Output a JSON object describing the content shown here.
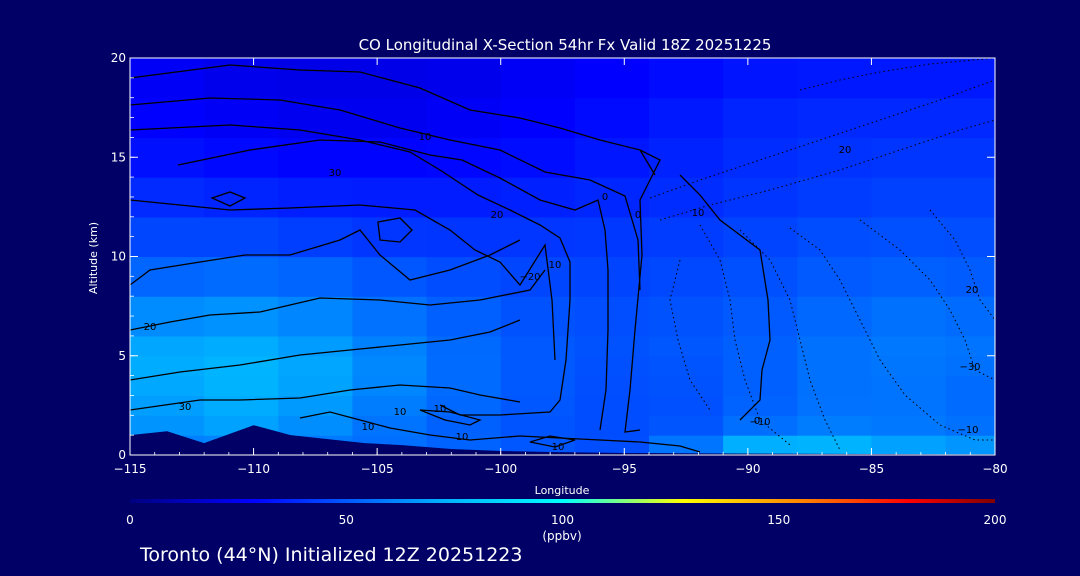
{
  "chart_data": {
    "type": "heatmap",
    "title": "CO Longitudinal X-Section 54hr  Fx Valid 18Z 20251225",
    "xlabel": "Longitude",
    "ylabel": "Altitude (km)",
    "xlim": [
      -115,
      -80
    ],
    "ylim": [
      0,
      20
    ],
    "x_ticks": [
      -115,
      -110,
      -105,
      -100,
      -95,
      -90,
      -85,
      -80
    ],
    "x_tick_labels": [
      "−115",
      "−110",
      "−105",
      "−100",
      "−95",
      "−90",
      "−85",
      "−80"
    ],
    "y_ticks": [
      0,
      5,
      10,
      15,
      20
    ],
    "y_tick_labels": [
      "0",
      "5",
      "10",
      "15",
      "20"
    ],
    "colorbar": {
      "min": 0,
      "max": 200,
      "ticks": [
        0,
        50,
        100,
        150,
        200
      ],
      "tick_labels": [
        "0",
        "50",
        "100",
        "150",
        "200"
      ],
      "units": "(ppbv)",
      "colors": [
        "#000080",
        "#0000ff",
        "#00b0ff",
        "#00ffff",
        "#ffff00",
        "#ff8000",
        "#ff0000",
        "#800000"
      ]
    },
    "field": {
      "x": [
        -115,
        -112,
        -109,
        -106,
        -103,
        -100,
        -97,
        -94,
        -91,
        -88,
        -85,
        -82,
        -80
      ],
      "z": [
        0,
        1,
        2,
        3,
        4,
        5,
        6,
        8,
        10,
        12,
        14,
        16,
        18,
        20
      ],
      "values": [
        [
          55,
          56,
          55,
          55,
          55,
          52,
          48,
          48,
          80,
          90,
          80,
          75,
          72
        ],
        [
          60,
          68,
          66,
          58,
          54,
          50,
          48,
          46,
          55,
          62,
          60,
          58,
          56
        ],
        [
          62,
          70,
          70,
          60,
          55,
          50,
          48,
          46,
          50,
          56,
          58,
          56,
          54
        ],
        [
          66,
          72,
          72,
          64,
          58,
          52,
          48,
          46,
          50,
          54,
          58,
          56,
          54
        ],
        [
          68,
          74,
          74,
          66,
          58,
          52,
          48,
          48,
          50,
          54,
          58,
          56,
          54
        ],
        [
          68,
          74,
          72,
          66,
          58,
          52,
          48,
          48,
          50,
          54,
          58,
          58,
          56
        ],
        [
          66,
          70,
          68,
          62,
          56,
          52,
          48,
          50,
          50,
          54,
          58,
          58,
          56
        ],
        [
          56,
          60,
          60,
          56,
          52,
          48,
          46,
          46,
          48,
          50,
          54,
          54,
          52
        ],
        [
          48,
          50,
          50,
          46,
          44,
          44,
          44,
          44,
          46,
          48,
          50,
          50,
          48
        ],
        [
          42,
          42,
          40,
          38,
          38,
          38,
          40,
          40,
          42,
          44,
          46,
          46,
          46
        ],
        [
          36,
          34,
          32,
          32,
          32,
          32,
          34,
          36,
          38,
          40,
          42,
          42,
          42
        ],
        [
          30,
          28,
          26,
          26,
          26,
          28,
          30,
          34,
          38,
          40,
          40,
          40,
          40
        ],
        [
          28,
          26,
          24,
          24,
          24,
          26,
          28,
          30,
          34,
          36,
          36,
          36,
          36
        ],
        [
          26,
          24,
          22,
          22,
          22,
          24,
          26,
          28,
          30,
          32,
          32,
          32,
          32
        ]
      ]
    },
    "contour_labels": [
      "10",
      "30",
      "20",
      "10",
      "0",
      "10",
      "20",
      "30",
      "20",
      "10",
      "10",
      "0",
      "10",
      "10",
      "10",
      "0",
      "−10",
      "20",
      "−30",
      "−20",
      "−10"
    ],
    "terrain_km": [
      [
        -115,
        1.0
      ],
      [
        -113.5,
        1.2
      ],
      [
        -112,
        0.6
      ],
      [
        -110,
        1.5
      ],
      [
        -108.5,
        1.0
      ],
      [
        -107,
        0.8
      ],
      [
        -105.5,
        0.6
      ],
      [
        -104,
        0.5
      ],
      [
        -102,
        0.3
      ],
      [
        -100,
        0.2
      ],
      [
        -98,
        0.15
      ],
      [
        -95,
        0.1
      ],
      [
        -92,
        0.08
      ],
      [
        -88,
        0.06
      ],
      [
        -85,
        0.05
      ],
      [
        -82,
        0.04
      ],
      [
        -80,
        0.04
      ]
    ],
    "footer": "Toronto (44°N) Initialized 12Z 20251223"
  }
}
